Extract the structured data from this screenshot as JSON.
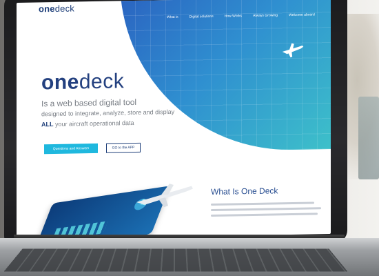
{
  "site": {
    "logo_one": "one",
    "logo_deck": "deck",
    "nav": [
      "What is",
      "Digital solutions",
      "How Works",
      "Always Growing",
      "Welcome aboard"
    ],
    "headline_one": "one",
    "headline_deck": "deck",
    "tagline_1": "Is a web based digital tool",
    "tagline_2": "designed to integrate, analyze, store and display",
    "tagline_3_bold": "ALL",
    "tagline_3_rest": " your aircraft operational data",
    "btn_questions": "Questions and Answers",
    "btn_app": "GO to the APP",
    "section_title": "What Is One Deck"
  },
  "colors": {
    "brand_dark": "#1c3d78",
    "brand_accent": "#1fb8de",
    "wave_start": "#2a5fbf",
    "wave_end": "#3fc6c9"
  },
  "icons": [
    "plane-icon",
    "chart-pie-icon"
  ]
}
